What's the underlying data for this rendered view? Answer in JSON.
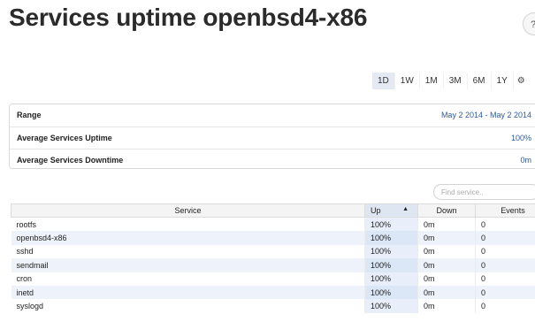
{
  "page": {
    "title": "Services uptime openbsd4-x86",
    "help_label": "?"
  },
  "range_tabs": {
    "items": [
      "1D",
      "1W",
      "1M",
      "3M",
      "6M",
      "1Y"
    ],
    "active": "1D",
    "settings_icon": "gear-icon"
  },
  "summary": {
    "range_label": "Range",
    "range_value": "May 2 2014 - May 2 2014",
    "avg_uptime_label": "Average Services Uptime",
    "avg_uptime_value": "100%",
    "avg_downtime_label": "Average Services Downtime",
    "avg_downtime_value": "0m"
  },
  "search": {
    "placeholder": "Find service.."
  },
  "table": {
    "headers": {
      "service": "Service",
      "up": "Up",
      "down": "Down",
      "events": "Events"
    },
    "sort_icon": "sort-ascending-icon",
    "rows": [
      {
        "service": "rootfs",
        "up": "100%",
        "down": "0m",
        "events": "0"
      },
      {
        "service": "openbsd4-x86",
        "up": "100%",
        "down": "0m",
        "events": "0"
      },
      {
        "service": "sshd",
        "up": "100%",
        "down": "0m",
        "events": "0"
      },
      {
        "service": "sendmail",
        "up": "100%",
        "down": "0m",
        "events": "0"
      },
      {
        "service": "cron",
        "up": "100%",
        "down": "0m",
        "events": "0"
      },
      {
        "service": "inetd",
        "up": "100%",
        "down": "0m",
        "events": "0"
      },
      {
        "service": "syslogd",
        "up": "100%",
        "down": "0m",
        "events": "0"
      }
    ]
  },
  "colors": {
    "accent_blue": "#2e5b96",
    "active_tab_bg": "#e4eaf3",
    "row_alt_bg": "#eef3fb"
  }
}
